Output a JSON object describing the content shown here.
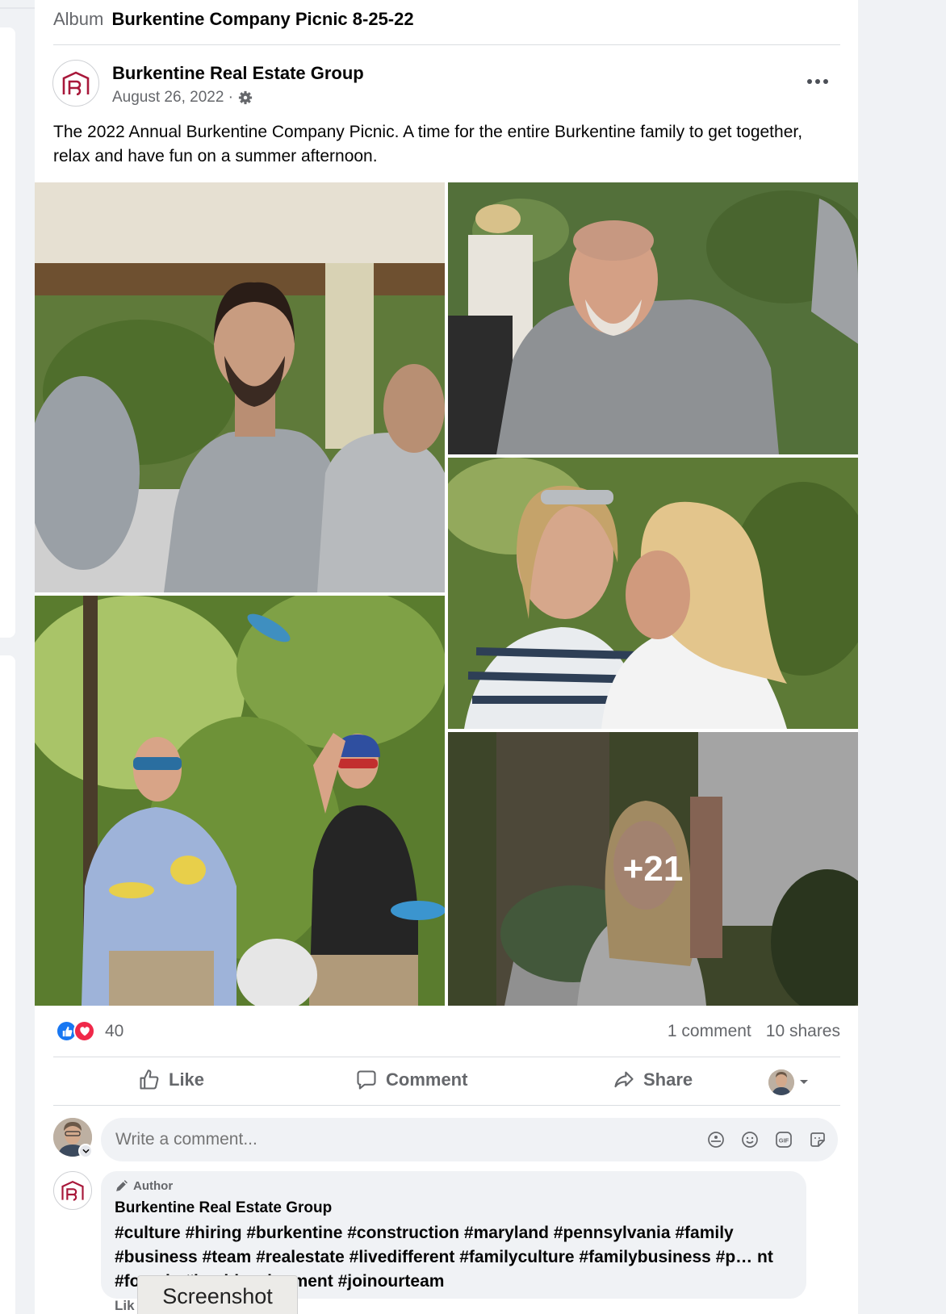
{
  "album": {
    "label": "Album",
    "name": "Burkentine Company Picnic 8-25-22"
  },
  "post": {
    "author": "Burkentine Real Estate Group",
    "date": "August 26, 2022 · ",
    "audience_icon": "gear-icon",
    "description": "The 2022 Annual Burkentine Company Picnic. A time for the entire Burkentine family to get together, relax and have fun on a summer afternoon.",
    "more_photos": "+21"
  },
  "reactions": {
    "types": [
      "like",
      "love"
    ],
    "count": "40",
    "comments": "1 comment",
    "shares": "10 shares"
  },
  "actions": {
    "like": "Like",
    "comment": "Comment",
    "share": "Share"
  },
  "comment_input": {
    "placeholder": "Write a comment..."
  },
  "comment": {
    "badge": "Author",
    "author": "Burkentine Real Estate Group",
    "text": "#culture #hiring #burkentine #construction #maryland #pennsylvania #family #business #team #realestate #livedifferent #familyculture #familybusiness #p… nt #forsale #landdevelopment #joinourteam",
    "like_label": "Lik"
  },
  "tooltip": "Screenshot",
  "colors": {
    "brand": "#a8183a",
    "like": "#1877f2",
    "love": "#f02849"
  }
}
